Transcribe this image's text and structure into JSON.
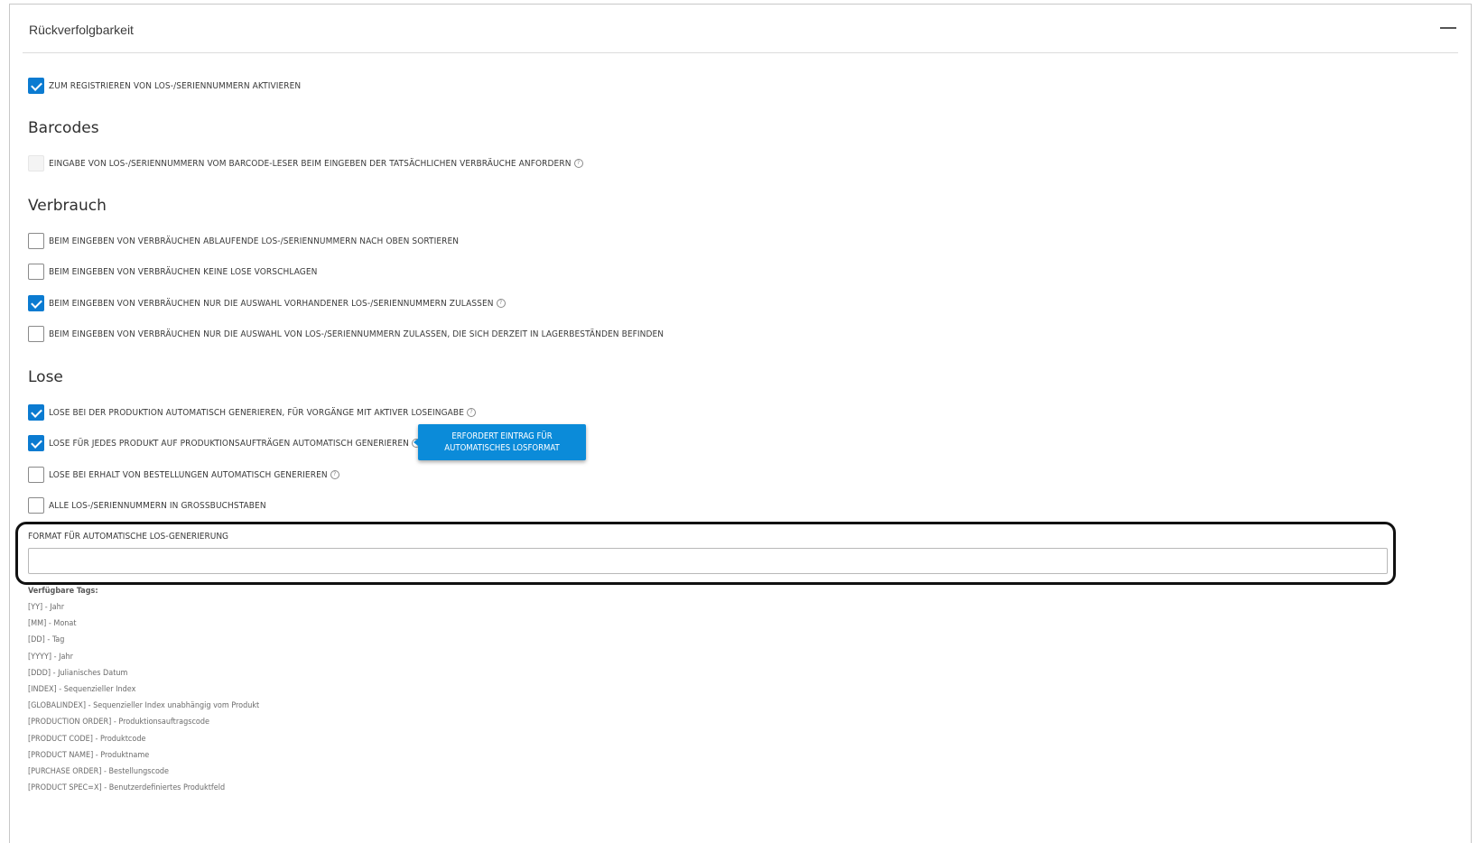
{
  "panel": {
    "title": "Rückverfolgbarkeit"
  },
  "options": {
    "enable": {
      "label": "ZUM REGISTRIEREN VON LOS-/SERIENNUMMERN AKTIVIEREN",
      "checked": true
    }
  },
  "barcodes": {
    "heading": "Barcodes",
    "items": [
      {
        "label": "EINGABE VON LOS-/SERIENNUMMERN VOM BARCODE-LESER BEIM EINGEBEN DER TATSÄCHLICHEN VERBRÄUCHE ANFORDERN",
        "checked": false,
        "disabled": true,
        "help": true
      }
    ]
  },
  "verbrauch": {
    "heading": "Verbrauch",
    "items": [
      {
        "label": "BEIM EINGEBEN VON VERBRÄUCHEN ABLAUFENDE LOS-/SERIENNUMMERN NACH OBEN SORTIEREN",
        "checked": false,
        "help": false
      },
      {
        "label": "BEIM EINGEBEN VON VERBRÄUCHEN KEINE LOSE VORSCHLAGEN",
        "checked": false,
        "help": false
      },
      {
        "label": "BEIM EINGEBEN VON VERBRÄUCHEN NUR DIE AUSWAHL VORHANDENER LOS-/SERIENNUMMERN ZULASSEN",
        "checked": true,
        "help": true
      },
      {
        "label": "BEIM EINGEBEN VON VERBRÄUCHEN NUR DIE AUSWAHL VON LOS-/SERIENNUMMERN ZULASSEN, DIE SICH DERZEIT IN LAGERBESTÄNDEN BEFINDEN",
        "checked": false,
        "help": false
      }
    ]
  },
  "lose": {
    "heading": "Lose",
    "items": [
      {
        "label": "LOSE BEI DER PRODUKTION AUTOMATISCH GENERIEREN, FÜR VORGÄNGE MIT AKTIVER LOSEINGABE",
        "checked": true,
        "help": true
      },
      {
        "label": "LOSE FÜR JEDES PRODUKT AUF PRODUKTIONSAUFTRÄGEN AUTOMATISCH GENERIEREN",
        "checked": true,
        "help": true
      },
      {
        "label": "LOSE BEI ERHALT VON BESTELLUNGEN AUTOMATISCH GENERIEREN",
        "checked": false,
        "help": true
      },
      {
        "label": "ALLE LOS-/SERIENNUMMERN IN GROSSBUCHSTABEN",
        "checked": false,
        "help": false
      }
    ],
    "tooltip": "ERFORDERT EINTRAG FÜR AUTOMATISCHES LOSFORMAT"
  },
  "format_field": {
    "label": "FORMAT FÜR AUTOMATISCHE LOS-GENERIERUNG",
    "value": "",
    "placeholder": ""
  },
  "tags": {
    "title": "Verfügbare Tags:",
    "items": [
      "[YY] - Jahr",
      "[MM] - Monat",
      "[DD] - Tag",
      "[YYYY] - Jahr",
      "[DDD] - Julianisches Datum",
      "[INDEX] - Sequenzieller Index",
      "[GLOBALINDEX] - Sequenzieller Index unabhängig vom Produkt",
      "[PRODUCTION ORDER] - Produktionsauftragscode",
      "[PRODUCT CODE] - Produktcode",
      "[PRODUCT NAME] - Produktname",
      "[PURCHASE ORDER] - Bestellungscode",
      "[PRODUCT SPEC=X] - Benutzerdefiniertes Produktfeld"
    ]
  },
  "colors": {
    "accent": "#0b7bd1",
    "tooltip_bg": "#0b8bd9"
  }
}
